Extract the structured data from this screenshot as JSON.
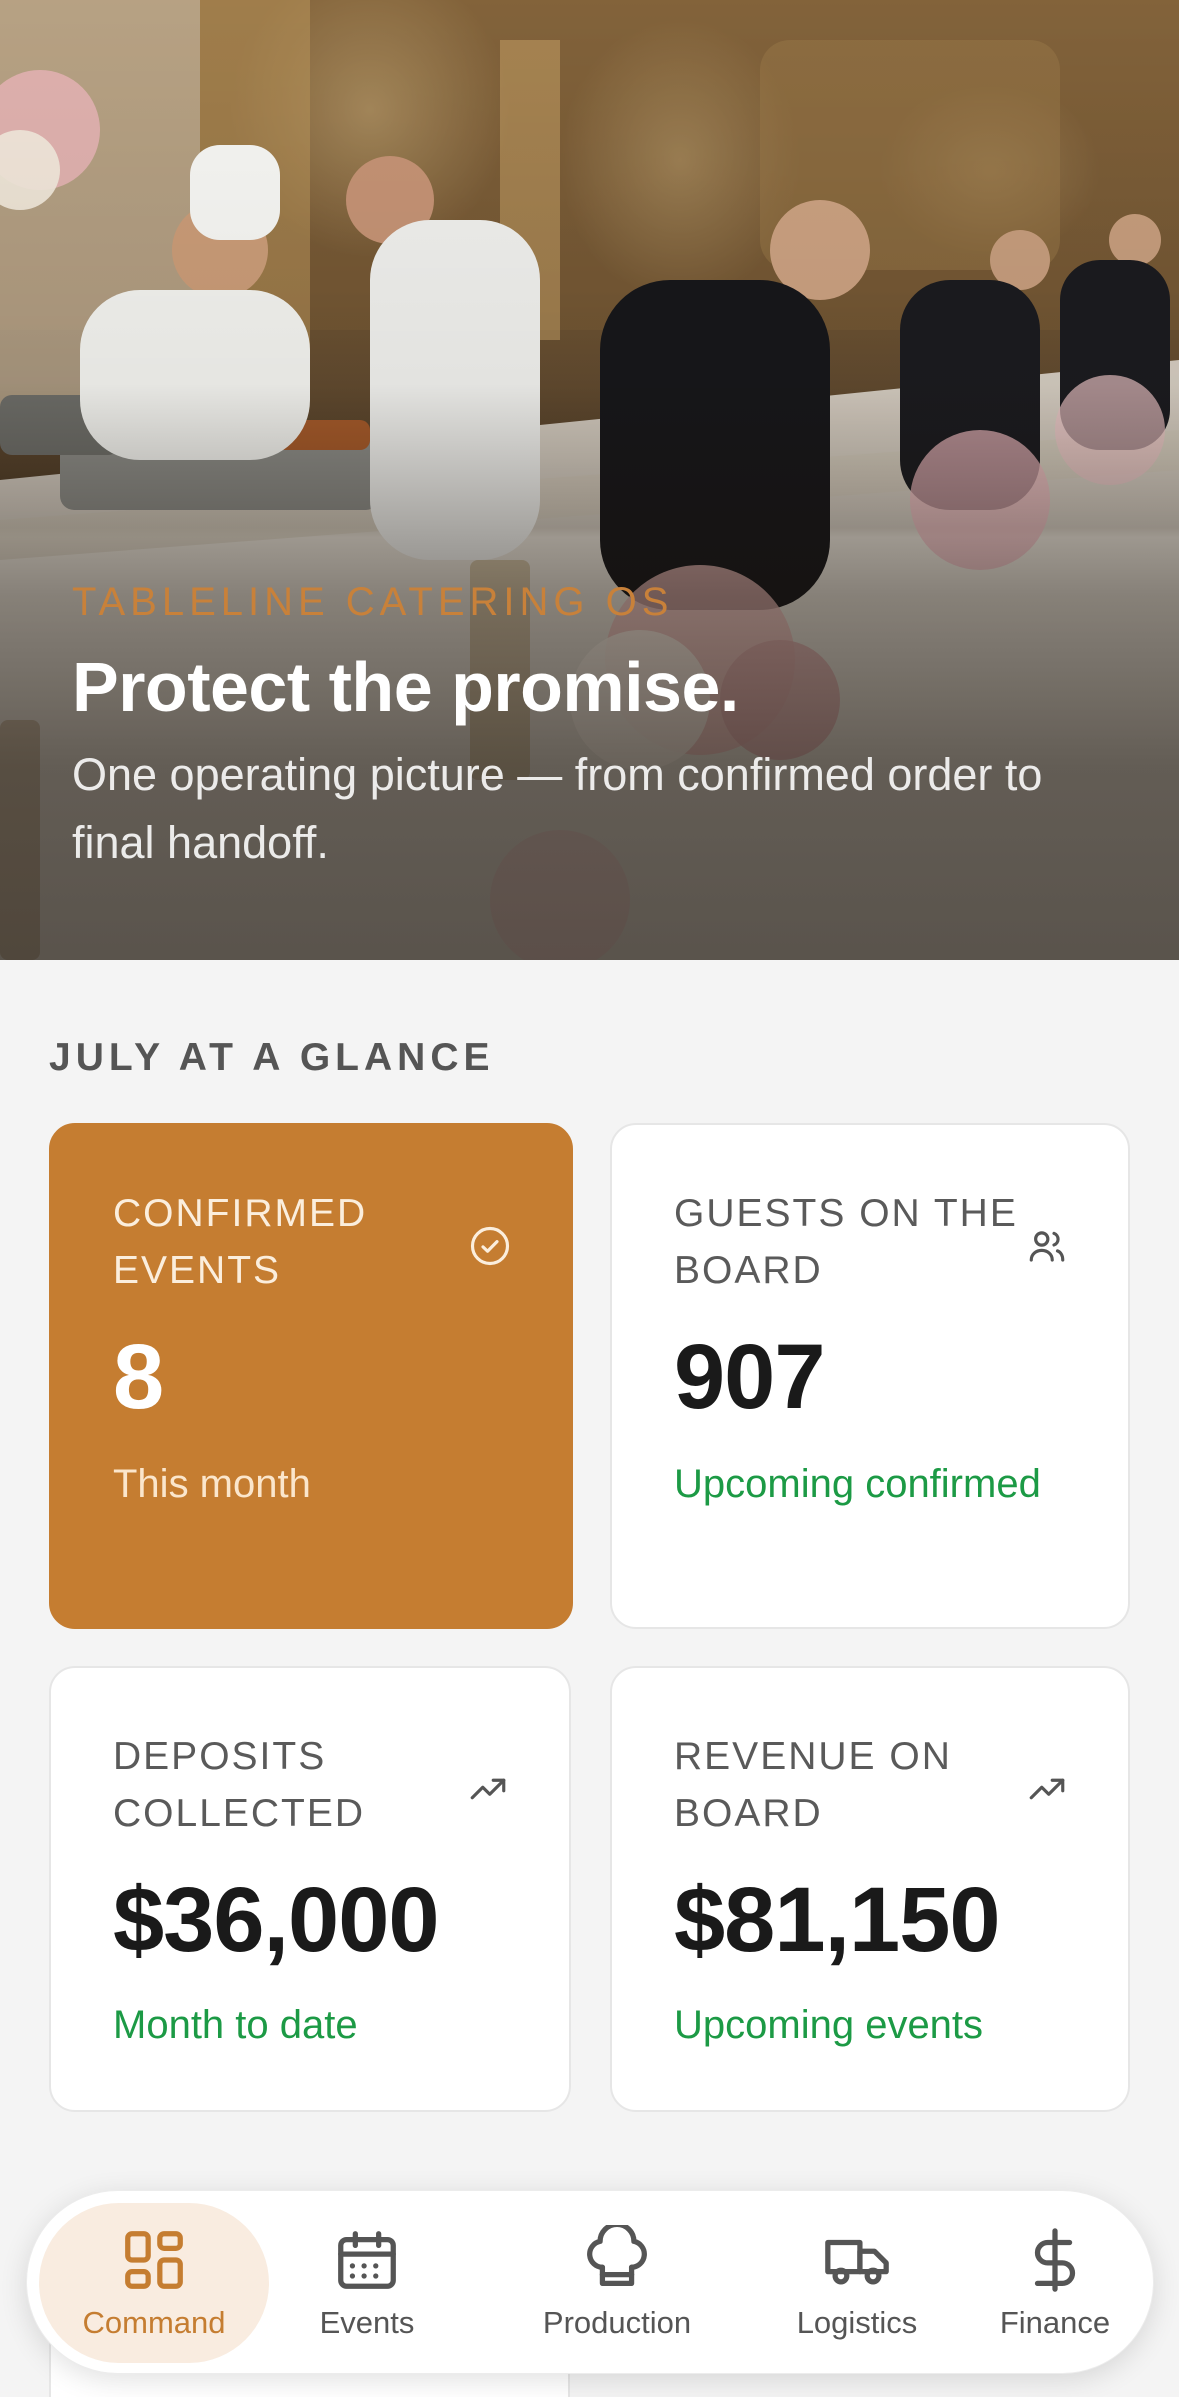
{
  "hero": {
    "eyebrow": "TABLELINE CATERING OS",
    "title": "Protect the promise.",
    "subtitle": "One operating picture — from confirmed order to final handoff."
  },
  "glance": {
    "section_label": "JULY AT A GLANCE",
    "cards": [
      {
        "label": "CONFIRMED EVENTS",
        "value": "8",
        "note": "This month",
        "icon": "check-circle-icon"
      },
      {
        "label": "GUESTS ON THE BOARD",
        "value": "907",
        "note": "Upcoming confirmed",
        "icon": "users-icon"
      },
      {
        "label": "DEPOSITS COLLECTED",
        "value": "$36,000",
        "note": "Month to date",
        "icon": "trending-up-icon"
      },
      {
        "label": "REVENUE ON BOARD",
        "value": "$81,150",
        "note": "Upcoming events",
        "icon": "trending-up-icon"
      }
    ]
  },
  "nav": {
    "items": [
      {
        "label": "Command",
        "icon": "dashboard-grid-icon",
        "active": true
      },
      {
        "label": "Events",
        "icon": "calendar-icon",
        "active": false
      },
      {
        "label": "Production",
        "icon": "chef-hat-icon",
        "active": false
      },
      {
        "label": "Logistics",
        "icon": "truck-icon",
        "active": false
      },
      {
        "label": "Finance",
        "icon": "dollar-icon",
        "active": false
      }
    ]
  },
  "colors": {
    "accent": "#c57d31",
    "positive": "#1c9a45",
    "background": "#f4f4f4"
  }
}
